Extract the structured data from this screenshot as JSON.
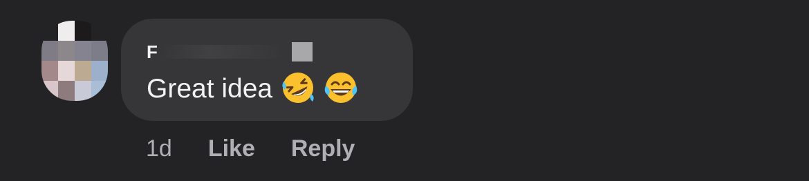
{
  "comment": {
    "author_initial": "F",
    "text": "Great idea",
    "reactions_emoji": [
      "rolling-on-floor-laughing",
      "face-with-tears-of-joy"
    ],
    "timestamp": "1d",
    "like_label": "Like",
    "reply_label": "Reply"
  },
  "colors": {
    "background": "#232325",
    "bubble": "#363638",
    "text": "#f2f2f2",
    "meta_text": "#b0b0b4",
    "emoji_yellow": "#fbc02d"
  },
  "avatar": {
    "pixel_colors": [
      "#232325",
      "#efedee",
      "#1c1a1b",
      "#232325",
      "#7f7c85",
      "#8b878b",
      "#858390",
      "#7d7d8a",
      "#a3898a",
      "#e6d7d9",
      "#bcaa93",
      "#9cb0cc",
      "#d9c6cb",
      "#8e7b7e",
      "#c8cad8",
      "#a9bdd6"
    ]
  }
}
